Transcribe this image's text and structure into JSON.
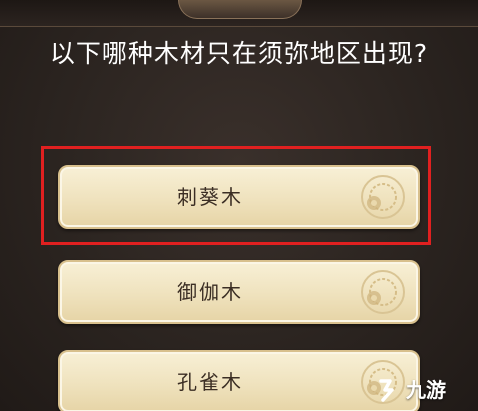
{
  "question": "以下哪种木材只在须弥地区出现?",
  "options": [
    {
      "label": "刺葵木",
      "highlighted": true
    },
    {
      "label": "御伽木",
      "highlighted": false
    },
    {
      "label": "孔雀木",
      "highlighted": false
    }
  ],
  "highlight_color": "#e02020",
  "option_text_color": "#3b2e24",
  "watermark": {
    "text": "九游",
    "icon": "jiuyou-logo-icon"
  }
}
